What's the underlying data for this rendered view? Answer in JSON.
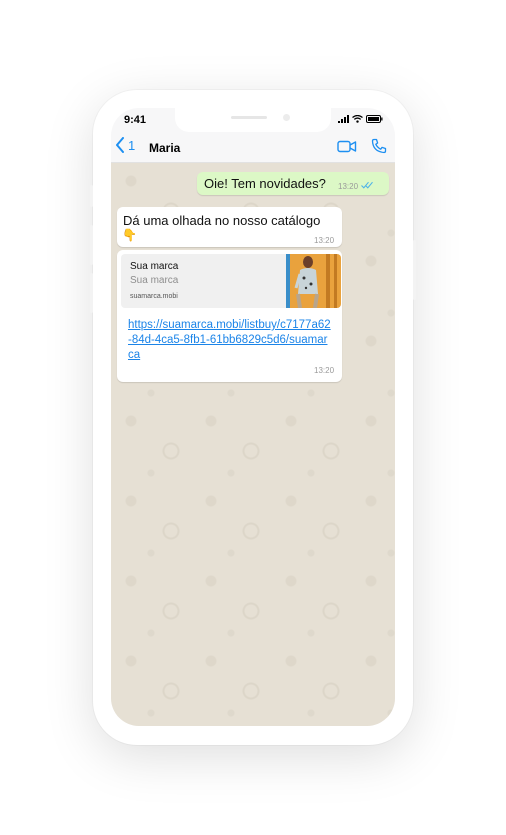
{
  "status": {
    "time": "9:41"
  },
  "header": {
    "back_count": "1",
    "contact_name": "Maria"
  },
  "messages": [
    {
      "direction": "outgoing",
      "text": "Oie! Tem novidades?",
      "time": "13:20",
      "read": true
    },
    {
      "direction": "incoming",
      "text": "Dá uma olhada no nosso catálogo",
      "emoji": "👇",
      "time": "13:20"
    },
    {
      "direction": "incoming",
      "preview": {
        "title": "Sua marca",
        "description": "Sua marca",
        "domain": "suamarca.mobi"
      },
      "link": "https://suamarca.mobi/listbuy/c7177a62-84d-4ca5-8fb1-61bb6829c5d6/suamarca",
      "time": "13:20"
    }
  ],
  "colors": {
    "accent": "#1d8ff1",
    "outgoing_bubble": "#dcf8c6",
    "link": "#1b84e8",
    "chat_background": "#e6e0d4"
  }
}
